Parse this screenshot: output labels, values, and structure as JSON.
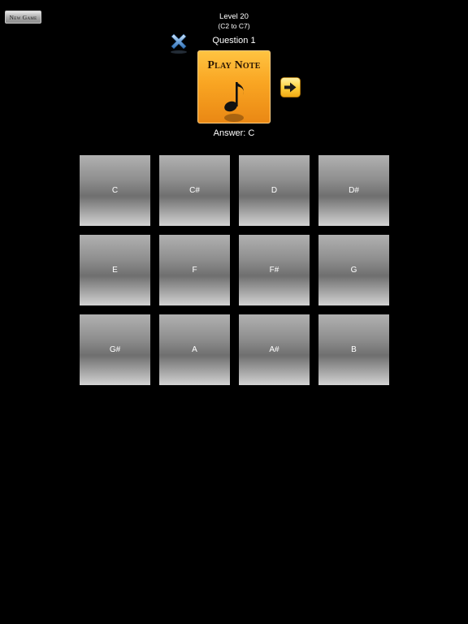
{
  "new_game_label": "New Game",
  "level": {
    "title": "Level 20",
    "range": "(C2 to C7)"
  },
  "question_label": "Question 1",
  "play_button_label": "Play Note",
  "answer_label": "Answer: C",
  "icons": {
    "close": "close-x-icon",
    "music": "music-note-icon",
    "next": "arrow-right-icon"
  },
  "colors": {
    "play_button": "#f9a522",
    "next_button": "#ffd23f",
    "close_icon": "#6fa3d8"
  },
  "notes": [
    "C",
    "C#",
    "D",
    "D#",
    "E",
    "F",
    "F#",
    "G",
    "G#",
    "A",
    "A#",
    "B"
  ]
}
